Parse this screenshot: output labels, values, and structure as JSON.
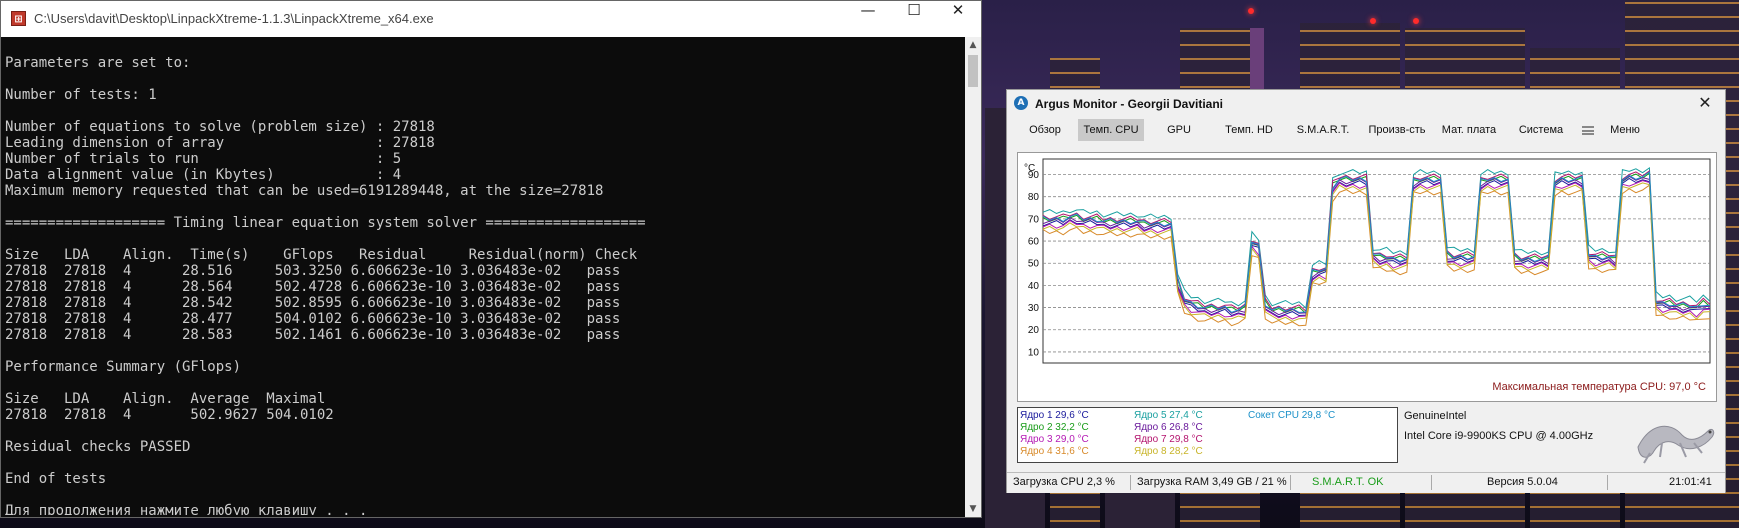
{
  "console": {
    "title": "C:\\Users\\davit\\Desktop\\LinpackXtreme-1.1.3\\LinpackXtreme_x64.exe",
    "lines": [
      "Parameters are set to:",
      "",
      "Number of tests: 1",
      "",
      "Number of equations to solve (problem size) : 27818",
      "Leading dimension of array                  : 27818",
      "Number of trials to run                     : 5",
      "Data alignment value (in Kbytes)            : 4",
      "Maximum memory requested that can be used=6191289448, at the size=27818",
      "",
      "=================== Timing linear equation system solver ===================",
      "",
      "Size   LDA    Align.  Time(s)    GFlops   Residual     Residual(norm) Check",
      "27818  27818  4      28.516     503.3250 6.606623e-10 3.036483e-02   pass",
      "27818  27818  4      28.564     502.4728 6.606623e-10 3.036483e-02   pass",
      "27818  27818  4      28.542     502.8595 6.606623e-10 3.036483e-02   pass",
      "27818  27818  4      28.477     504.0102 6.606623e-10 3.036483e-02   pass",
      "27818  27818  4      28.583     502.1461 6.606623e-10 3.036483e-02   pass",
      "",
      "Performance Summary (GFlops)",
      "",
      "Size   LDA    Align.  Average  Maximal",
      "27818  27818  4       502.9627 504.0102",
      "",
      "Residual checks PASSED",
      "",
      "End of tests",
      "",
      "Для продолжения нажмите любую клавишу . . ."
    ],
    "buttons": {
      "minimize": "—",
      "maximize": "☐",
      "close": "✕"
    }
  },
  "argus": {
    "title": "Argus Monitor - Georgii Davitiani",
    "close": "✕",
    "tabs": [
      "Обзор",
      "Темп. CPU",
      "GPU",
      "Темп. HD",
      "S.M.A.R.T.",
      "Произв-сть",
      "Мат. плата",
      "Система",
      "Меню"
    ],
    "active_tab": 1,
    "max_temp_label": "Максимальная температура CPU: 97,0 °C",
    "legend": [
      {
        "text": "Ядро 1 29,6 °C",
        "color": "#1a1a9c"
      },
      {
        "text": "Ядро 2 32,2 °C",
        "color": "#1a9c1a"
      },
      {
        "text": "Ядро 3 29,0 °C",
        "color": "#b41ab4"
      },
      {
        "text": "Ядро 4 31,6 °C",
        "color": "#d88a2a"
      },
      {
        "text": "Ядро 5 27,4 °C",
        "color": "#1aa0a0"
      },
      {
        "text": "Ядро 6 26,8 °C",
        "color": "#6a1a9c"
      },
      {
        "text": "Ядро 7 29,8 °C",
        "color": "#b4146e"
      },
      {
        "text": "Ядро 8 28,2 °C",
        "color": "#c8b428"
      },
      {
        "text": "Сокет CPU 29,8 °C",
        "color": "#1a90c8"
      }
    ],
    "cpu_vendor": "GenuineIntel",
    "cpu_model": "Intel Core i9-9900KS CPU @ 4.00GHz",
    "status": {
      "cpu_load": "Загрузка CPU 2,3 %",
      "ram_load": "Загрузка RAM 3,49 GB / 21 %",
      "smart": "S.M.A.R.T. OK",
      "version": "Версия 5.0.04",
      "time": "21:01:41"
    }
  },
  "chart_data": {
    "type": "line",
    "title": "",
    "xlabel": "",
    "ylabel": "°C",
    "ylim": [
      5,
      97
    ],
    "yticks": [
      10,
      20,
      30,
      40,
      50,
      60,
      70,
      80,
      90
    ],
    "grid": true,
    "legend_placement": "bottom-left",
    "baseline_series": [
      68,
      68,
      68,
      68,
      69,
      69,
      68,
      68,
      68,
      67,
      67,
      67,
      67,
      67,
      67,
      66,
      66,
      66,
      66,
      66,
      40,
      32,
      30,
      29,
      28,
      28,
      28,
      28,
      27,
      27,
      28,
      58,
      56,
      30,
      27,
      27,
      27,
      27,
      27,
      26,
      44,
      45,
      45,
      83,
      86,
      86,
      86,
      86,
      86,
      52,
      51,
      51,
      50,
      50,
      50,
      85,
      86,
      86,
      86,
      86,
      52,
      51,
      51,
      51,
      51,
      85,
      86,
      86,
      86,
      86,
      51,
      50,
      50,
      50,
      50,
      50,
      85,
      86,
      86,
      86,
      86,
      52,
      51,
      51,
      51,
      50,
      86,
      87,
      87,
      87,
      88,
      31,
      30,
      30,
      29,
      29,
      29,
      28,
      30,
      29
    ],
    "series": [
      {
        "name": "Ядро 1",
        "color": "#1a1a9c",
        "offset": 0
      },
      {
        "name": "Ядро 2",
        "color": "#1a9c1a",
        "offset": 2
      },
      {
        "name": "Ядро 3",
        "color": "#b41ab4",
        "offset": -1
      },
      {
        "name": "Ядро 4",
        "color": "#d88a2a",
        "offset": -4
      },
      {
        "name": "Ядро 5",
        "color": "#1aa0a0",
        "offset": 5
      },
      {
        "name": "Ядро 6",
        "color": "#6a1a9c",
        "offset": 1
      },
      {
        "name": "Ядро 7",
        "color": "#b4146e",
        "offset": 3
      },
      {
        "name": "Ядро 8",
        "color": "#c8b428",
        "offset": -2
      },
      {
        "name": "Сокет CPU",
        "color": "#1a90c8",
        "offset": 2
      }
    ]
  }
}
